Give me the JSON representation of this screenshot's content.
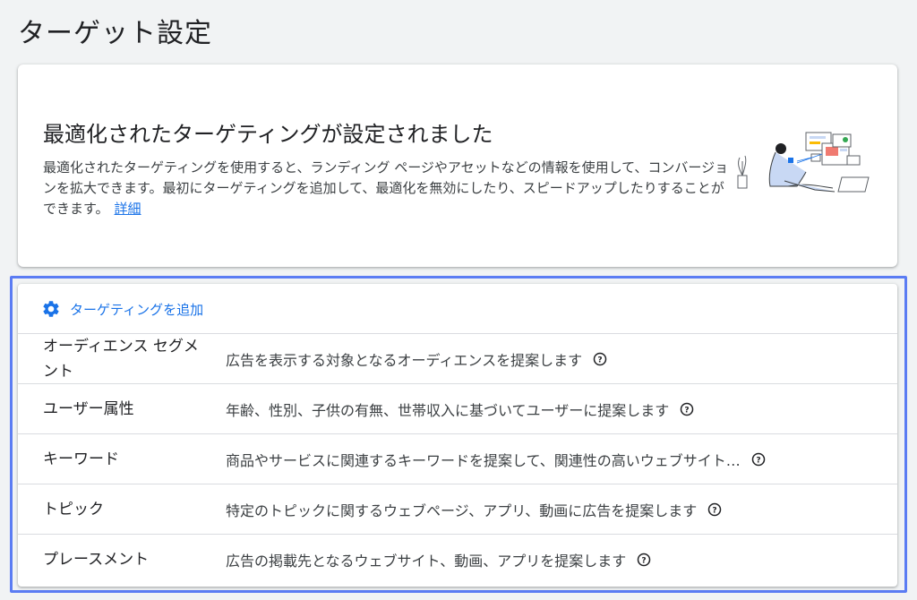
{
  "page": {
    "title": "ターゲット設定"
  },
  "info": {
    "heading": "最適化されたターゲティングが設定されました",
    "body": "最適化されたターゲティングを使用すると、ランディング ページやアセットなどの情報を使用して、コンバージョンを拡大できます。最初にターゲティングを追加して、最適化を無効にしたり、スピードアップしたりすることができます。",
    "link": "詳細",
    "illustration": "person-with-laptop-illustration"
  },
  "targeting": {
    "add_label": "ターゲティングを追加",
    "add_icon": "gear-icon",
    "accent": "#1a73e8",
    "focus_color": "#5b7cf3",
    "rows": [
      {
        "name": "オーディエンス セグメント",
        "desc": "広告を表示する対象となるオーディエンスを提案します"
      },
      {
        "name": "ユーザー属性",
        "desc": "年齢、性別、子供の有無、世帯収入に基づいてユーザーに提案します"
      },
      {
        "name": "キーワード",
        "desc": "商品やサービスに関連するキーワードを提案して、関連性の高いウェブサイト…"
      },
      {
        "name": "トピック",
        "desc": "特定のトピックに関するウェブページ、アプリ、動画に広告を提案します"
      },
      {
        "name": "プレースメント",
        "desc": "広告の掲載先となるウェブサイト、動画、アプリを提案します"
      }
    ],
    "help_icon": "help-circle-icon"
  }
}
